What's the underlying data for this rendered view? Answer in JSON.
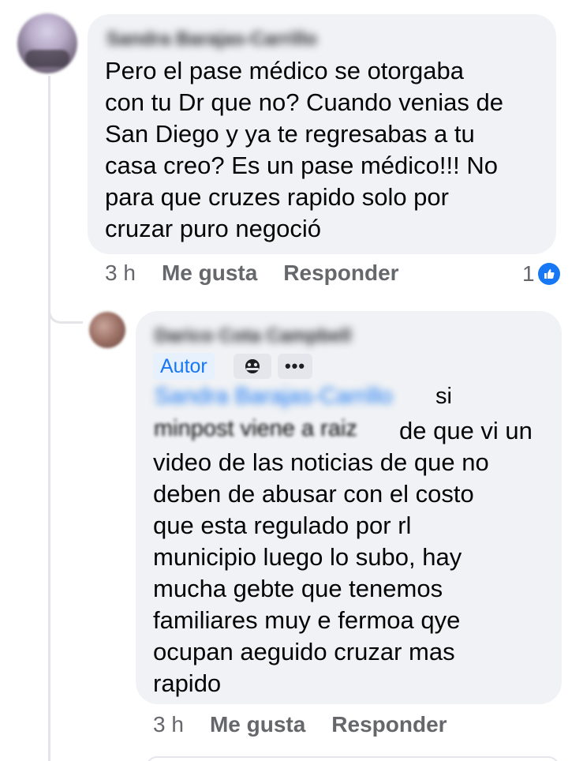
{
  "comment": {
    "author": "Sandra Barajas-Carrillo",
    "text": "Pero el pase médico se otorgaba\ncon tu Dr que no? Cuando venias de\nSan Diego y ya te regresabas a tu\ncasa creo? Es un pase médico!!! No\npara que cruzes rapido solo por\ncruzar puro negoció",
    "time": "3 h",
    "like_label": "Me gusta",
    "reply_label": "Responder",
    "reaction_count": "1",
    "reaction_icon": "thumbs-up-icon",
    "accent_color": "#1877f2"
  },
  "reply": {
    "author": "Darico Cota Campbell",
    "badge": "Autor",
    "mention": "Sandra Barajas-Carrillo",
    "mention_suffix": "si",
    "line2_blurred": "minpost viene a raiz",
    "line2_rest": "de que vi un",
    "text": "video de las noticias de que no\ndeben de abusar con el costo\nque esta regulado por rl\nmunicipio luego lo subo, hay\nmucha gebte que tenemos\nfamiliares muy e fermoa qye\nocupan aeguido cruzar mas\nrapido",
    "more_label": "•••",
    "fan_icon": "top-fan-icon",
    "time": "3 h",
    "like_label": "Me gusta",
    "reply_label": "Responder"
  }
}
